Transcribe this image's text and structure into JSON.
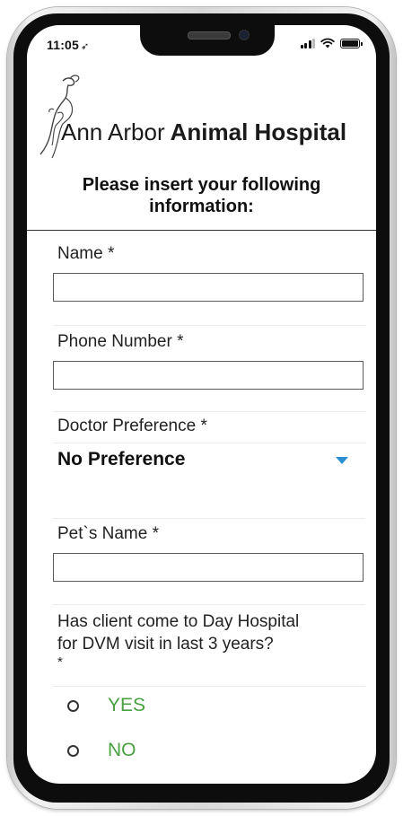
{
  "status_bar": {
    "time": "11:05",
    "location_glyph": "➶",
    "signal_icon": "cellular-signal-icon",
    "wifi_icon": "wifi-icon",
    "battery_icon": "battery-icon"
  },
  "logo": {
    "text_light": "Ann Arbor",
    "text_bold": "Animal Hospital"
  },
  "form": {
    "heading_line1": "Please insert your following",
    "heading_line2": "information:",
    "name_label": "Name *",
    "name_value": "",
    "phone_label": "Phone Number *",
    "phone_value": "",
    "doctor_label": "Doctor Preference *",
    "doctor_selected": "No Preference",
    "pet_label": "Pet`s Name *",
    "pet_value": "",
    "question_line1": "Has client come to Day Hospital",
    "question_line2": "for DVM visit in last 3 years?",
    "question_required": "*",
    "options": [
      "YES",
      "NO"
    ]
  },
  "colors": {
    "accent_blue": "#2a8fd0",
    "option_green": "#48a040",
    "frame_dark": "#0d0d0d"
  }
}
